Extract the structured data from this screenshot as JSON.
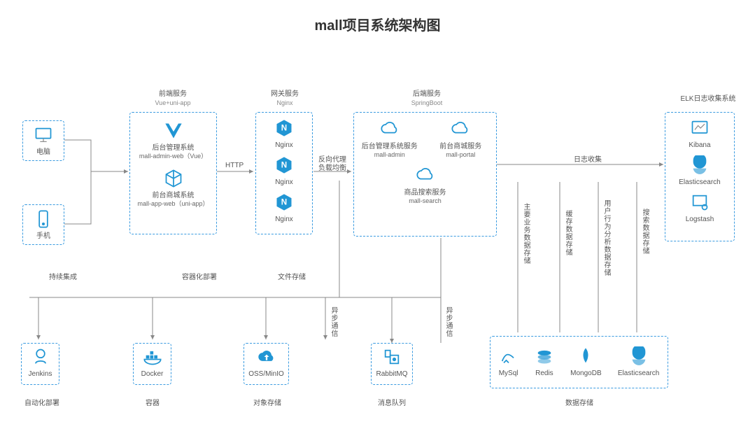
{
  "title": "mall项目系统架构图",
  "clients": {
    "pc": "电脑",
    "phone": "手机"
  },
  "groups": {
    "frontend": {
      "title": "前端服务",
      "sub": "Vue+uni-app",
      "adminWeb": "后台管理系统",
      "adminWebSub": "mall-admin-web（Vue）",
      "appWeb": "前台商城系统",
      "appWebSub": "mall-app-web（uni-app）"
    },
    "gateway": {
      "title": "网关服务",
      "sub": "Nginx",
      "nginx": "Nginx"
    },
    "backend": {
      "title": "后端服务",
      "sub": "SpringBoot",
      "admin": "后台管理系统服务",
      "adminSub": "mall-admin",
      "portal": "前台商城服务",
      "portalSub": "mall-portal",
      "search": "商品搜索服务",
      "searchSub": "mall-search"
    },
    "elk": {
      "title": "ELK日志收集系统",
      "kibana": "Kibana",
      "es": "Elasticsearch",
      "logstash": "Logstash"
    },
    "storage": {
      "mysql": "MySql",
      "redis": "Redis",
      "mongo": "MongoDB",
      "es": "Elasticsearch"
    }
  },
  "singles": {
    "jenkins": "Jenkins",
    "docker": "Docker",
    "oss": "OSS/MinIO",
    "rabbit": "RabbitMQ"
  },
  "edges": {
    "http": "HTTP",
    "lb": "反向代理\n负载均衡",
    "log": "日志收集",
    "main": "主要业务数据存储",
    "cache": "缓存数据存储",
    "behavior": "用户行为分析数据存储",
    "searchStore": "搜索数据存储",
    "async1": "异步通信",
    "async2": "异步通信",
    "ci": "持续集成",
    "container": "容器化部署",
    "file": "文件存储"
  },
  "footer": {
    "auto": "自动化部署",
    "container": "容器",
    "obj": "对象存储",
    "mq": "消息队列",
    "data": "数据存储"
  }
}
